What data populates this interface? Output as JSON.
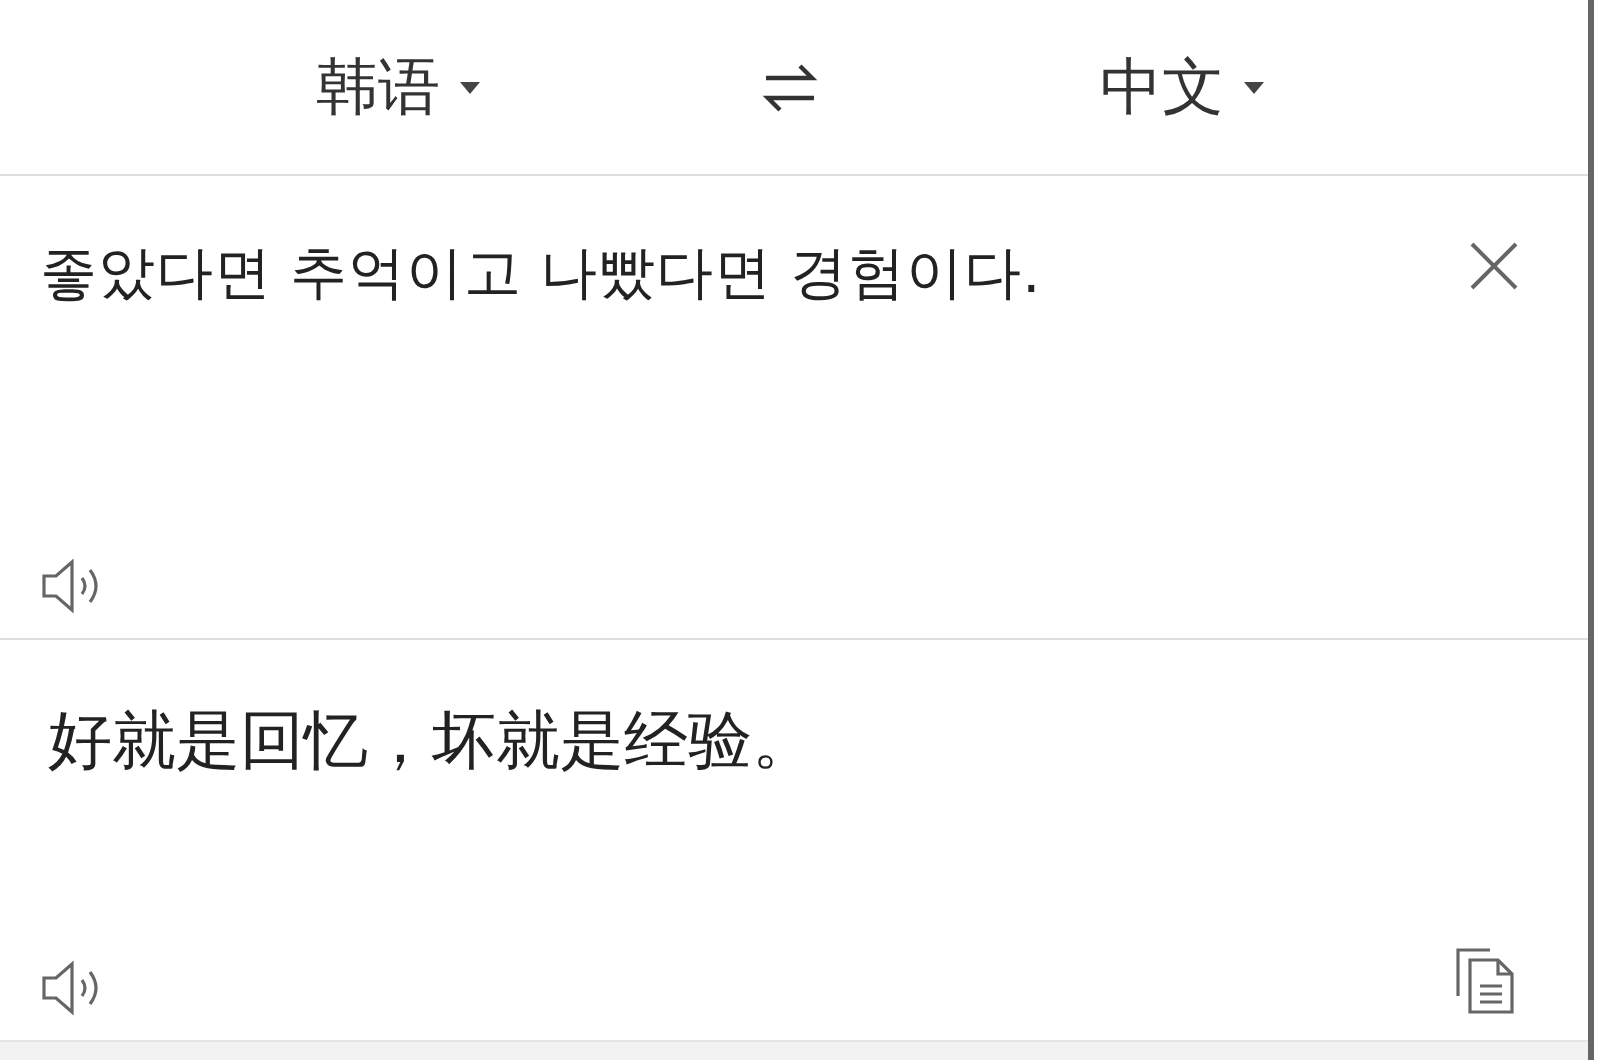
{
  "header": {
    "source_language": "韩语",
    "target_language": "中文"
  },
  "source": {
    "text": "좋았다면 추억이고 나빴다면 경험이다."
  },
  "translation": {
    "text": "好就是回忆，坏就是经验。"
  }
}
